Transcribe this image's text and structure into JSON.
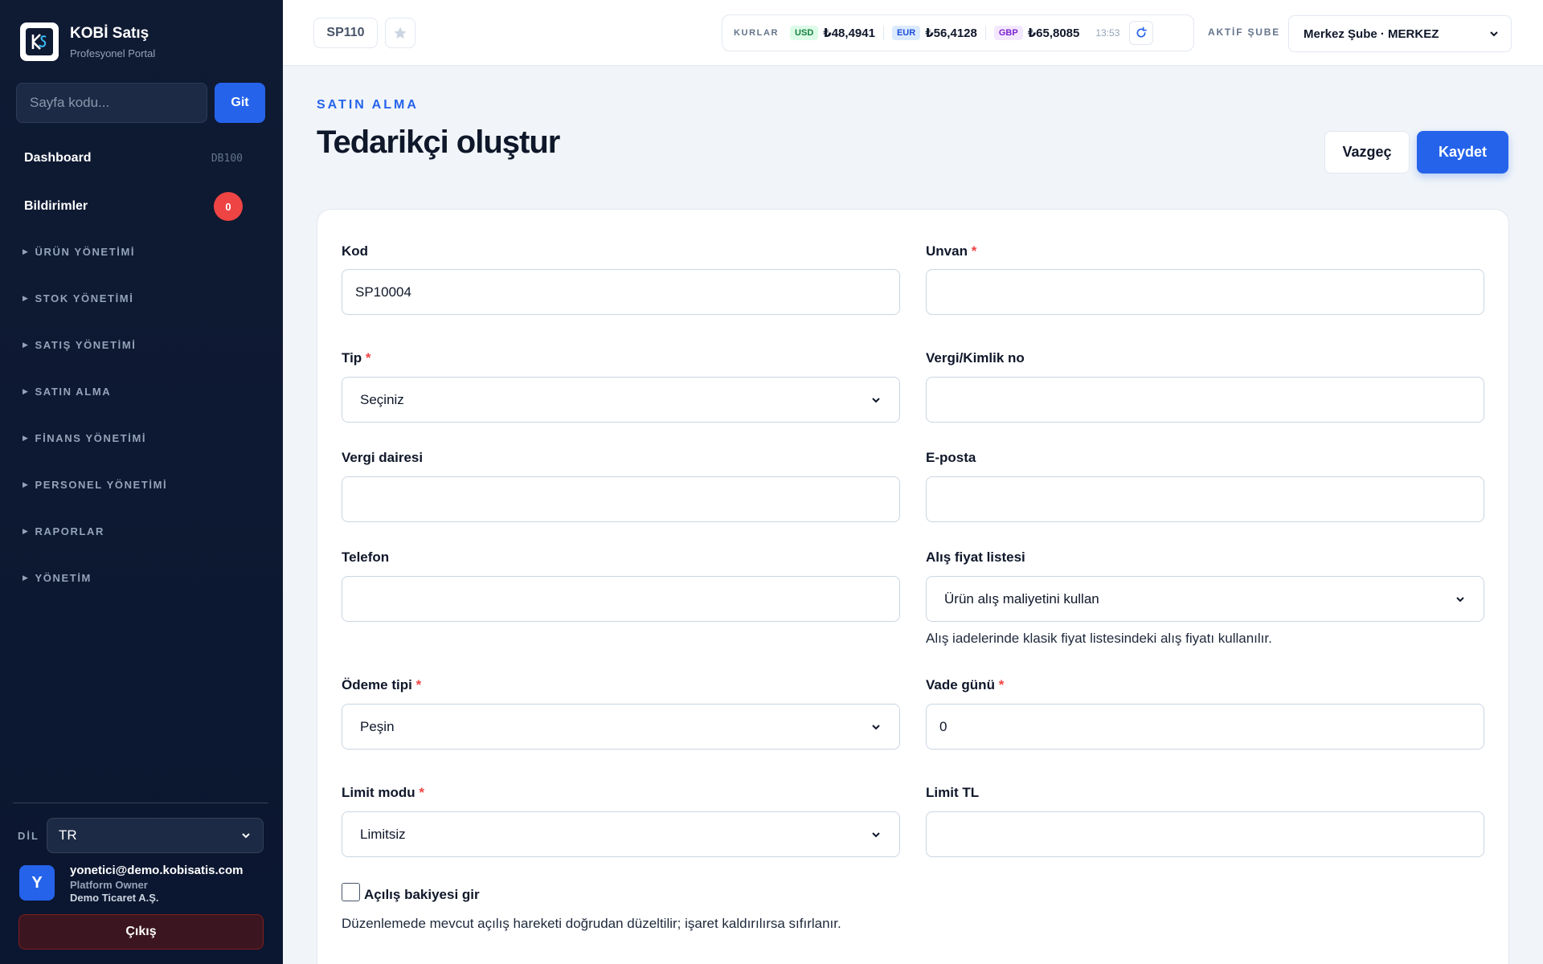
{
  "brand": {
    "title": "KOBİ Satış",
    "subtitle": "Profesyonel Portal"
  },
  "sidebar": {
    "search_placeholder": "Sayfa kodu...",
    "go_label": "Git",
    "dashboard": {
      "label": "Dashboard",
      "code": "DB100"
    },
    "notifications": {
      "label": "Bildirimler",
      "count": "0"
    },
    "groups": [
      "ÜRÜN YÖNETİMİ",
      "STOK YÖNETİMİ",
      "SATIŞ YÖNETİMİ",
      "SATIN ALMA",
      "FİNANS YÖNETİMİ",
      "PERSONEL YÖNETİMİ",
      "RAPORLAR",
      "YÖNETİM"
    ],
    "lang_label": "DİL",
    "lang_value": "TR",
    "user": {
      "initial": "Y",
      "email": "yonetici@demo.kobisatis.com",
      "role": "Platform Owner",
      "company": "Demo Ticaret A.Ş."
    },
    "logout_label": "Çıkış"
  },
  "topbar": {
    "page_code": "SP110",
    "rates_label": "KURLAR",
    "rates": [
      {
        "currency": "USD",
        "value": "₺48,4941"
      },
      {
        "currency": "EUR",
        "value": "₺56,4128"
      },
      {
        "currency": "GBP",
        "value": "₺65,8085"
      }
    ],
    "rate_time": "13:53",
    "branch_label": "AKTİF ŞUBE",
    "branch_value": "Merkez Şube · MERKEZ"
  },
  "page": {
    "section": "SATIN ALMA",
    "title": "Tedarikçi oluştur",
    "cancel_label": "Vazgeç",
    "save_label": "Kaydet"
  },
  "form": {
    "kod": {
      "label": "Kod",
      "value": "SP10004"
    },
    "unvan": {
      "label": "Unvan",
      "value": ""
    },
    "tip": {
      "label": "Tip",
      "value": "Seçiniz"
    },
    "vergi_no": {
      "label": "Vergi/Kimlik no",
      "value": ""
    },
    "vergi_dairesi": {
      "label": "Vergi dairesi",
      "value": ""
    },
    "eposta": {
      "label": "E-posta",
      "value": ""
    },
    "telefon": {
      "label": "Telefon",
      "value": ""
    },
    "alis_fiyat": {
      "label": "Alış fiyat listesi",
      "value": "Ürün alış maliyetini kullan",
      "help": "Alış iadelerinde klasik fiyat listesindeki alış fiyatı kullanılır."
    },
    "odeme_tipi": {
      "label": "Ödeme tipi",
      "value": "Peşin"
    },
    "vade_gunu": {
      "label": "Vade günü",
      "value": "0"
    },
    "limit_modu": {
      "label": "Limit modu",
      "value": "Limitsiz"
    },
    "limit_tl": {
      "label": "Limit TL",
      "value": ""
    },
    "acilis": {
      "label": "Açılış bakiyesi gir",
      "checked": false,
      "help": "Düzenlemede mevcut açılış hareketi doğrudan düzeltilir; işaret kaldırılırsa sıfırlanır."
    }
  },
  "colors": {
    "accent": "#2563eb",
    "sidebar_bg": "#0f1a33",
    "danger": "#ef4444"
  }
}
